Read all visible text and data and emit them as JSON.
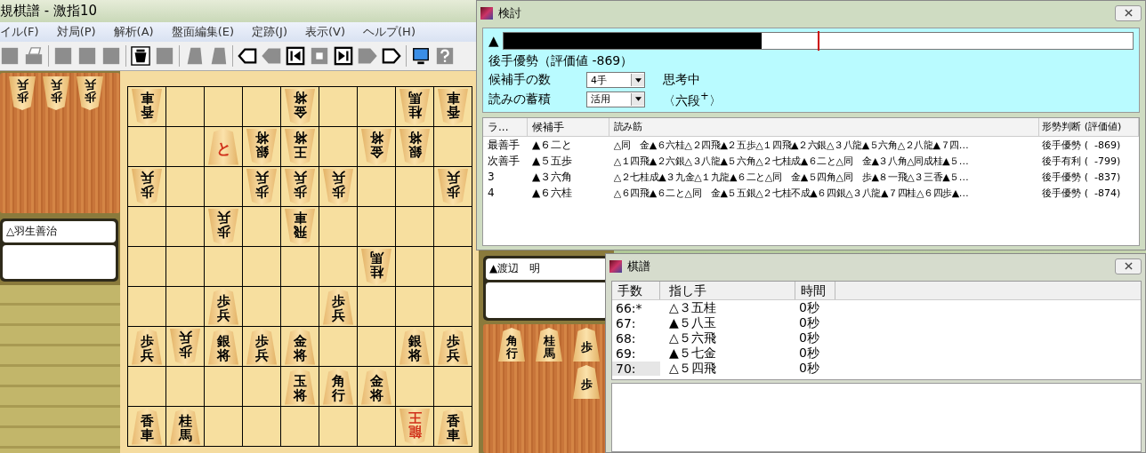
{
  "main_window": {
    "title": "規棋譜 - 激指10",
    "menu": [
      "イル(F)",
      "対局(P)",
      "解析(A)",
      "盤面編集(E)",
      "定跡(J)",
      "表示(V)",
      "ヘルプ(H)"
    ],
    "toolbar": [
      {
        "items": [
          {
            "kind": "square",
            "disabled": true
          },
          {
            "kind": "printer",
            "disabled": true
          }
        ]
      },
      {
        "items": [
          {
            "kind": "square",
            "disabled": true
          },
          {
            "kind": "square",
            "disabled": true
          },
          {
            "kind": "square",
            "disabled": true
          }
        ]
      },
      {
        "items": [
          {
            "kind": "teacup",
            "disabled": false
          },
          {
            "kind": "square",
            "disabled": true
          }
        ]
      },
      {
        "items": [
          {
            "kind": "piece",
            "disabled": true
          },
          {
            "kind": "piece",
            "disabled": true
          }
        ]
      },
      {
        "items": [
          {
            "kind": "back-end",
            "disabled": false
          },
          {
            "kind": "back",
            "disabled": true
          },
          {
            "kind": "skip-start",
            "disabled": false
          },
          {
            "kind": "stop",
            "disabled": true
          },
          {
            "kind": "skip-end",
            "disabled": false
          },
          {
            "kind": "forward",
            "disabled": true
          },
          {
            "kind": "forward-end",
            "disabled": false
          }
        ]
      },
      {
        "items": [
          {
            "kind": "monitor",
            "disabled": false
          },
          {
            "kind": "help",
            "disabled": true
          }
        ]
      }
    ]
  },
  "gote": {
    "name": "△羽生善治",
    "hand": [
      "歩兵",
      "歩兵",
      "歩兵"
    ]
  },
  "sente": {
    "name": "▲渡辺　明",
    "hand": [
      "角行",
      "桂馬",
      "歩",
      "歩"
    ]
  },
  "board": {
    "rows": [
      {
        "cells": [
          {
            "kind": "piece",
            "piece": "香車",
            "upside_down": true,
            "promoted": false
          },
          {
            "kind": "empty"
          },
          {
            "kind": "empty"
          },
          {
            "kind": "empty"
          },
          {
            "kind": "piece",
            "piece": "金将",
            "upside_down": true,
            "promoted": false
          },
          {
            "kind": "empty"
          },
          {
            "kind": "empty"
          },
          {
            "kind": "piece",
            "piece": "桂馬",
            "upside_down": true,
            "promoted": false
          },
          {
            "kind": "piece",
            "piece": "香車",
            "upside_down": true,
            "promoted": false
          }
        ]
      },
      {
        "cells": [
          {
            "kind": "empty"
          },
          {
            "kind": "empty"
          },
          {
            "kind": "piece",
            "piece": "と",
            "upside_down": false,
            "promoted": true
          },
          {
            "kind": "piece",
            "piece": "銀将",
            "upside_down": true,
            "promoted": false
          },
          {
            "kind": "piece",
            "piece": "王将",
            "upside_down": true,
            "promoted": false
          },
          {
            "kind": "empty"
          },
          {
            "kind": "piece",
            "piece": "金将",
            "upside_down": true,
            "promoted": false
          },
          {
            "kind": "piece",
            "piece": "銀将",
            "upside_down": true,
            "promoted": false
          },
          {
            "kind": "empty"
          }
        ]
      },
      {
        "cells": [
          {
            "kind": "piece",
            "piece": "歩兵",
            "upside_down": true,
            "promoted": false
          },
          {
            "kind": "empty"
          },
          {
            "kind": "empty"
          },
          {
            "kind": "piece",
            "piece": "歩兵",
            "upside_down": true,
            "promoted": false
          },
          {
            "kind": "piece",
            "piece": "歩兵",
            "upside_down": true,
            "promoted": false
          },
          {
            "kind": "piece",
            "piece": "歩兵",
            "upside_down": true,
            "promoted": false
          },
          {
            "kind": "empty"
          },
          {
            "kind": "empty"
          },
          {
            "kind": "piece",
            "piece": "歩兵",
            "upside_down": true,
            "promoted": false
          }
        ]
      },
      {
        "cells": [
          {
            "kind": "empty"
          },
          {
            "kind": "empty"
          },
          {
            "kind": "piece",
            "piece": "歩兵",
            "upside_down": true,
            "promoted": false
          },
          {
            "kind": "empty"
          },
          {
            "kind": "piece",
            "piece": "飛車",
            "upside_down": true,
            "promoted": false
          },
          {
            "kind": "empty"
          },
          {
            "kind": "empty"
          },
          {
            "kind": "empty"
          },
          {
            "kind": "empty"
          }
        ]
      },
      {
        "cells": [
          {
            "kind": "empty"
          },
          {
            "kind": "empty"
          },
          {
            "kind": "empty"
          },
          {
            "kind": "empty"
          },
          {
            "kind": "empty"
          },
          {
            "kind": "empty"
          },
          {
            "kind": "piece",
            "piece": "桂馬",
            "upside_down": true,
            "promoted": false
          },
          {
            "kind": "empty"
          },
          {
            "kind": "empty"
          }
        ]
      },
      {
        "cells": [
          {
            "kind": "empty"
          },
          {
            "kind": "empty"
          },
          {
            "kind": "piece",
            "piece": "歩兵",
            "upside_down": false,
            "promoted": false
          },
          {
            "kind": "empty"
          },
          {
            "kind": "empty"
          },
          {
            "kind": "piece",
            "piece": "歩兵",
            "upside_down": false,
            "promoted": false
          },
          {
            "kind": "empty"
          },
          {
            "kind": "empty"
          },
          {
            "kind": "empty"
          }
        ]
      },
      {
        "cells": [
          {
            "kind": "piece",
            "piece": "歩兵",
            "upside_down": false,
            "promoted": false
          },
          {
            "kind": "piece",
            "piece": "歩兵",
            "upside_down": true,
            "promoted": false
          },
          {
            "kind": "piece",
            "piece": "銀将",
            "upside_down": false,
            "promoted": false
          },
          {
            "kind": "piece",
            "piece": "歩兵",
            "upside_down": false,
            "promoted": false
          },
          {
            "kind": "piece",
            "piece": "金将",
            "upside_down": false,
            "promoted": false
          },
          {
            "kind": "empty"
          },
          {
            "kind": "empty"
          },
          {
            "kind": "piece",
            "piece": "銀将",
            "upside_down": false,
            "promoted": false
          },
          {
            "kind": "piece",
            "piece": "歩兵",
            "upside_down": false,
            "promoted": false
          }
        ]
      },
      {
        "cells": [
          {
            "kind": "empty"
          },
          {
            "kind": "empty"
          },
          {
            "kind": "empty"
          },
          {
            "kind": "empty"
          },
          {
            "kind": "piece",
            "piece": "玉将",
            "upside_down": false,
            "promoted": false
          },
          {
            "kind": "piece",
            "piece": "角行",
            "upside_down": false,
            "promoted": false
          },
          {
            "kind": "piece",
            "piece": "金将",
            "upside_down": false,
            "promoted": false
          },
          {
            "kind": "empty"
          },
          {
            "kind": "empty"
          }
        ]
      },
      {
        "cells": [
          {
            "kind": "piece",
            "piece": "香車",
            "upside_down": false,
            "promoted": false
          },
          {
            "kind": "piece",
            "piece": "桂馬",
            "upside_down": false,
            "promoted": false
          },
          {
            "kind": "empty"
          },
          {
            "kind": "empty"
          },
          {
            "kind": "empty"
          },
          {
            "kind": "empty"
          },
          {
            "kind": "empty"
          },
          {
            "kind": "piece",
            "piece": "龍王",
            "upside_down": true,
            "promoted": true
          },
          {
            "kind": "piece",
            "piece": "香車",
            "upside_down": false,
            "promoted": false
          }
        ]
      }
    ]
  },
  "analysis": {
    "title": "検討",
    "side_mark": "▲",
    "eval_bar": {
      "level": 0.41
    },
    "verdict": "後手優勢（評価値 -869）",
    "candidates_label": "候補手の数",
    "candidates_value": "4手",
    "status": "思考中",
    "reuse_label": "読みの蓄積",
    "reuse_value": "活用",
    "engine_level": "〈六段$^{+}$〉",
    "columns": [
      "ラ...",
      "候補手",
      "読み筋",
      "形勢判断 (評価値)"
    ],
    "rows": [
      {
        "rank": "最善手",
        "move": "▲６二と",
        "line": "△同　金▲６六桂△２四飛▲２五歩△１四飛▲２六銀△３八龍▲５六角△２八龍▲７四…",
        "judgement": "後手優勢 (  -869)"
      },
      {
        "rank": "次善手",
        "move": "▲５五歩",
        "line": "△１四飛▲２六銀△３八龍▲５六角△２七桂成▲６二と△同　金▲３八角△同成桂▲５…",
        "judgement": "後手有利 (  -799)"
      },
      {
        "rank": "3",
        "move": "▲３六角",
        "line": "△２七桂成▲３九金△１九龍▲６二と△同　金▲５四角△同　歩▲８一飛△３三香▲５…",
        "judgement": "後手優勢 (  -837)"
      },
      {
        "rank": "4",
        "move": "▲６六桂",
        "line": "△６四飛▲６二と△同　金▲５五銀△２七桂不成▲６四銀△３八龍▲７四桂△６四歩▲…",
        "judgement": "後手優勢 (  -874)"
      }
    ]
  },
  "kifu": {
    "title": "棋譜",
    "columns": [
      "手数",
      "指し手",
      "時間"
    ],
    "rows": [
      {
        "number": "66:*",
        "move": "△３五桂",
        "time": "0秒",
        "selected": false
      },
      {
        "number": "67:",
        "move": "▲５八玉",
        "time": "0秒",
        "selected": false
      },
      {
        "number": "68:",
        "move": "△５六飛",
        "time": "0秒",
        "selected": false
      },
      {
        "number": "69:",
        "move": "▲５七金",
        "time": "0秒",
        "selected": false
      },
      {
        "number": "70:",
        "move": "△５四飛",
        "time": "0秒",
        "selected": true
      }
    ]
  }
}
